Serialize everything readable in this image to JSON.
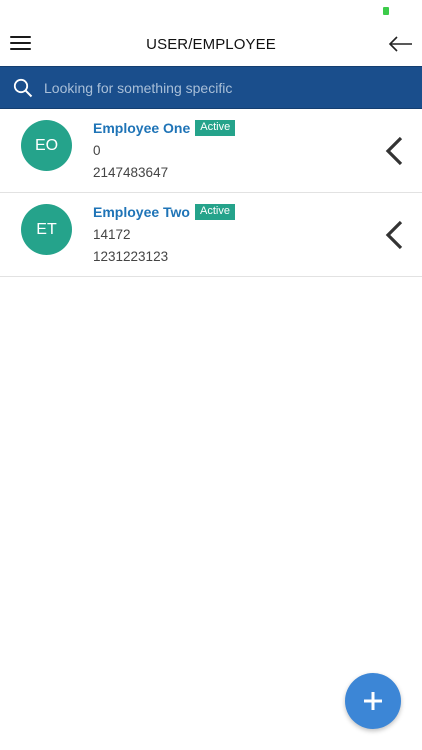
{
  "header": {
    "title": "USER/EMPLOYEE",
    "menu_icon": "hamburger-menu-icon",
    "back_icon": "arrow-left-icon"
  },
  "search": {
    "placeholder": "Looking for something specific",
    "value": "",
    "icon": "search-icon"
  },
  "employees": [
    {
      "initials": "EO",
      "name": "Employee One",
      "status": "Active",
      "line1": "0",
      "line2": "2147483647"
    },
    {
      "initials": "ET",
      "name": "Employee Two",
      "status": "Active",
      "line1": "14172",
      "line2": "1231223123"
    }
  ],
  "fab": {
    "icon": "plus-icon"
  },
  "colors": {
    "search_bar": "#1a4e8c",
    "avatar": "#25a38b",
    "badge": "#25a38b",
    "name_link": "#1f74b7",
    "fab": "#3c86d6",
    "battery": "#3ccb4a"
  }
}
